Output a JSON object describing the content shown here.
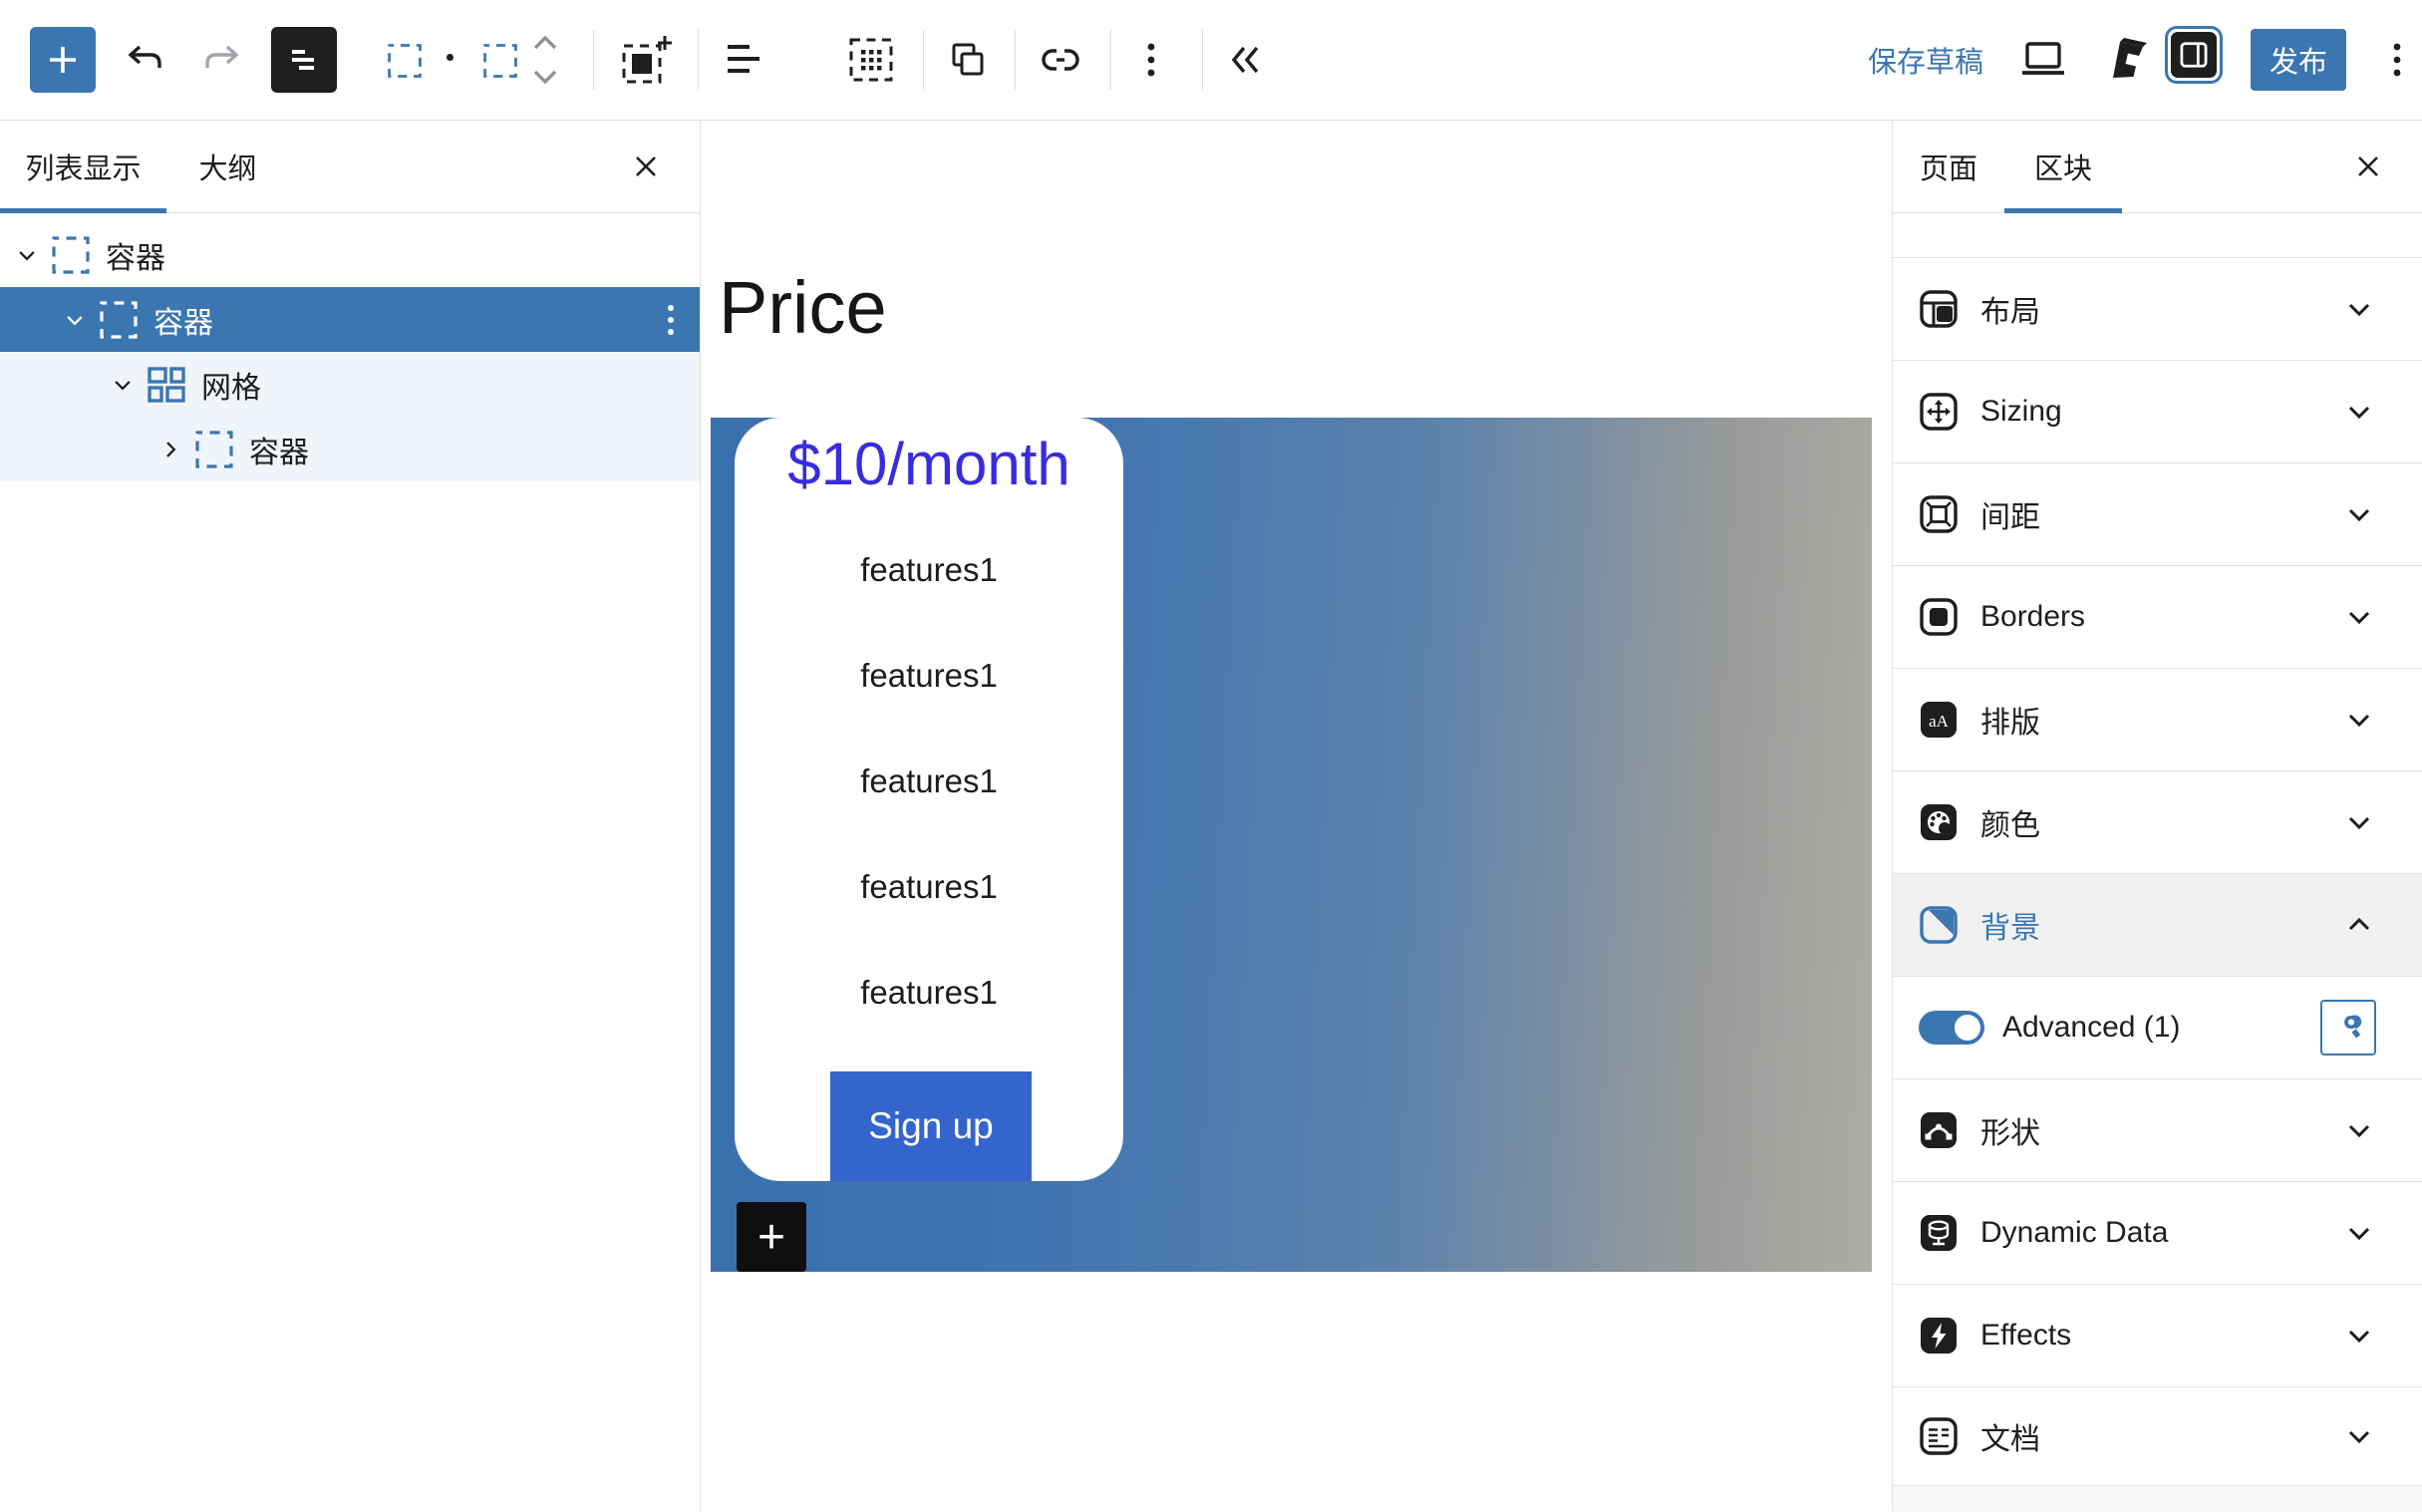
{
  "colors": {
    "accent": "#3b76b1",
    "price_text": "#392be0",
    "signup_button": "#3465cd",
    "banner_gradient_start": "#3a6fae",
    "banner_gradient_end": "#acaca9",
    "selected_row": "#3b76b1"
  },
  "toolbar": {
    "save_draft_label": "保存草稿",
    "publish_label": "发布",
    "icons": [
      "inserter-plus",
      "undo",
      "redo",
      "list-view",
      "select-parent",
      "select-block",
      "move-up",
      "move-down",
      "add-block",
      "align",
      "dotted-grid",
      "copy",
      "link",
      "options",
      "collapse",
      "preview-laptop",
      "generateblocks-logo",
      "sidebar-toggle",
      "more-options"
    ]
  },
  "list_panel": {
    "tabs": [
      {
        "label": "列表显示",
        "active": true
      },
      {
        "label": "大纲",
        "active": false
      }
    ],
    "tree": [
      {
        "label": "容器",
        "block": "container",
        "chevron": "down",
        "depth": 0,
        "state": "default"
      },
      {
        "label": "容器",
        "block": "container",
        "chevron": "down",
        "depth": 1,
        "state": "selected",
        "menu": true
      },
      {
        "label": "网格",
        "block": "grid",
        "chevron": "down",
        "depth": 2,
        "state": "descendant"
      },
      {
        "label": "容器",
        "block": "container",
        "chevron": "right",
        "depth": 3,
        "state": "descendant"
      }
    ]
  },
  "canvas": {
    "heading": "Price",
    "pricing_card": {
      "price": "$10/month",
      "features": [
        "features1",
        "features1",
        "features1",
        "features1",
        "features1"
      ],
      "signup_label": "Sign up"
    },
    "appender": "+"
  },
  "inspector": {
    "tabs": [
      {
        "label": "页面",
        "active": false
      },
      {
        "label": "区块",
        "active": true
      }
    ],
    "rows": [
      {
        "type": "section",
        "label": "布局",
        "icon": "layout-icon"
      },
      {
        "type": "section",
        "label": "Sizing",
        "icon": "sizing-icon"
      },
      {
        "type": "section",
        "label": "间距",
        "icon": "spacing-icon"
      },
      {
        "type": "section",
        "label": "Borders",
        "icon": "borders-icon"
      },
      {
        "type": "section",
        "label": "排版",
        "icon": "typography-icon"
      },
      {
        "type": "section",
        "label": "颜色",
        "icon": "colors-icon"
      },
      {
        "type": "section",
        "label": "背景",
        "icon": "background-icon",
        "expanded": true,
        "accent": true
      },
      {
        "type": "advanced",
        "label": "Advanced (1)",
        "toggle_on": true
      },
      {
        "type": "section",
        "label": "形状",
        "icon": "shapes-icon"
      },
      {
        "type": "section",
        "label": "Dynamic Data",
        "icon": "dynamic-data-icon"
      },
      {
        "type": "section",
        "label": "Effects",
        "icon": "effects-icon"
      },
      {
        "type": "section",
        "label": "文档",
        "icon": "document-icon"
      }
    ]
  }
}
